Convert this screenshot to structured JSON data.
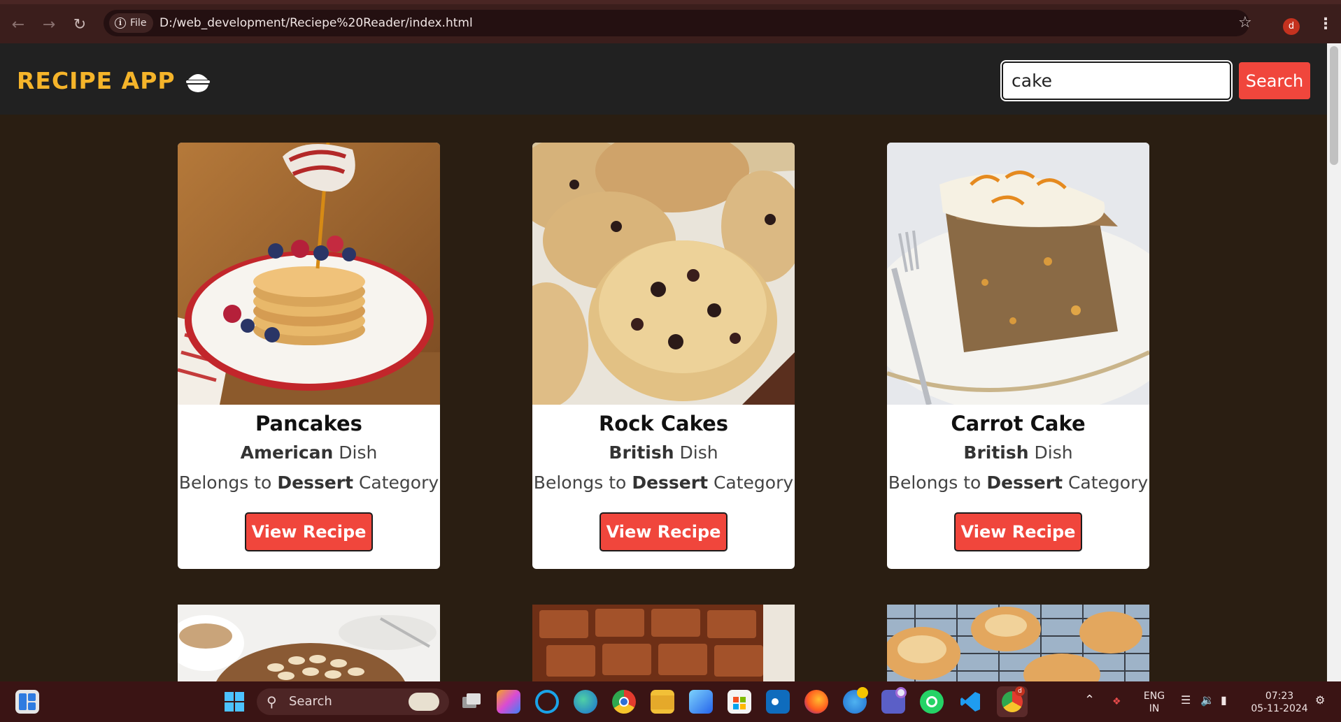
{
  "browser": {
    "site_chip": "File",
    "url": "D:/web_development/Reciepe%20Reader/index.html",
    "profile_initial": "d"
  },
  "app": {
    "title": "RECIPE APP",
    "search_value": "cake",
    "search_button": "Search"
  },
  "cards": [
    {
      "name": "Pancakes",
      "area": "American",
      "area_suffix": " Dish",
      "cat_prefix": "Belongs to ",
      "category": "Dessert",
      "cat_suffix": " Category",
      "button": "View Recipe"
    },
    {
      "name": "Rock Cakes",
      "area": "British",
      "area_suffix": " Dish",
      "cat_prefix": "Belongs to ",
      "category": "Dessert",
      "cat_suffix": " Category",
      "button": "View Recipe"
    },
    {
      "name": "Carrot Cake",
      "area": "British",
      "area_suffix": " Dish",
      "cat_prefix": "Belongs to ",
      "category": "Dessert",
      "cat_suffix": " Category",
      "button": "View Recipe"
    }
  ],
  "taskbar": {
    "search_label": "Search",
    "lang_line1": "ENG",
    "lang_line2": "IN",
    "time": "07:23",
    "date": "05-11-2024"
  }
}
